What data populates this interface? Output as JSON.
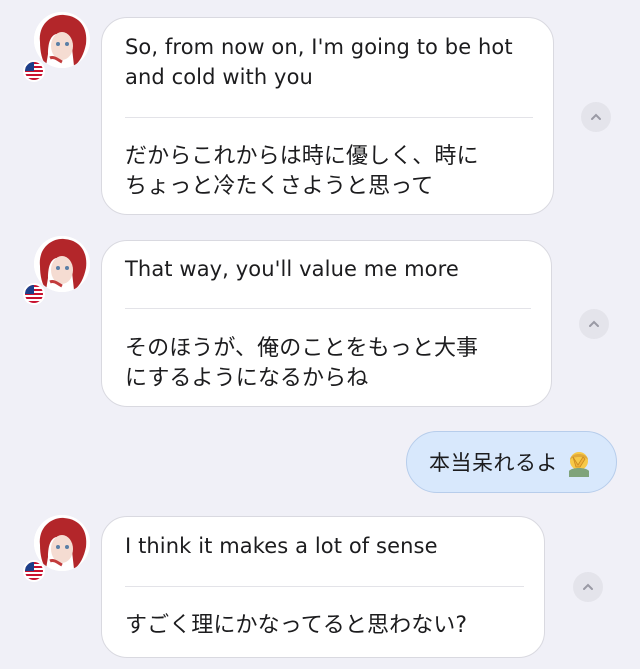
{
  "messages": [
    {
      "role": "assistant",
      "en": "So, from now on, I'm going to be hot\nand cold with you",
      "ja": "だからこれからは時に優しく、時に\nちょっと冷たくさようと思って"
    },
    {
      "role": "assistant",
      "en": "That way, you'll value me more",
      "ja": "そのほうが、俺のことをもっと大事\nにするようになるからね"
    },
    {
      "role": "user",
      "text": "本当呆れるよ",
      "emoji": "face-palm-emoji"
    },
    {
      "role": "assistant",
      "en": "I think it makes a lot of sense",
      "ja": "すごく理にかなってると思わない?"
    }
  ],
  "icons": {
    "avatar": "character-avatar",
    "flag": "us-flag-icon",
    "collapse": "chevron-up-icon"
  },
  "colors": {
    "background": "#f0f0f7",
    "assistant_bubble": "#ffffff",
    "user_bubble": "#d8e8fc"
  }
}
